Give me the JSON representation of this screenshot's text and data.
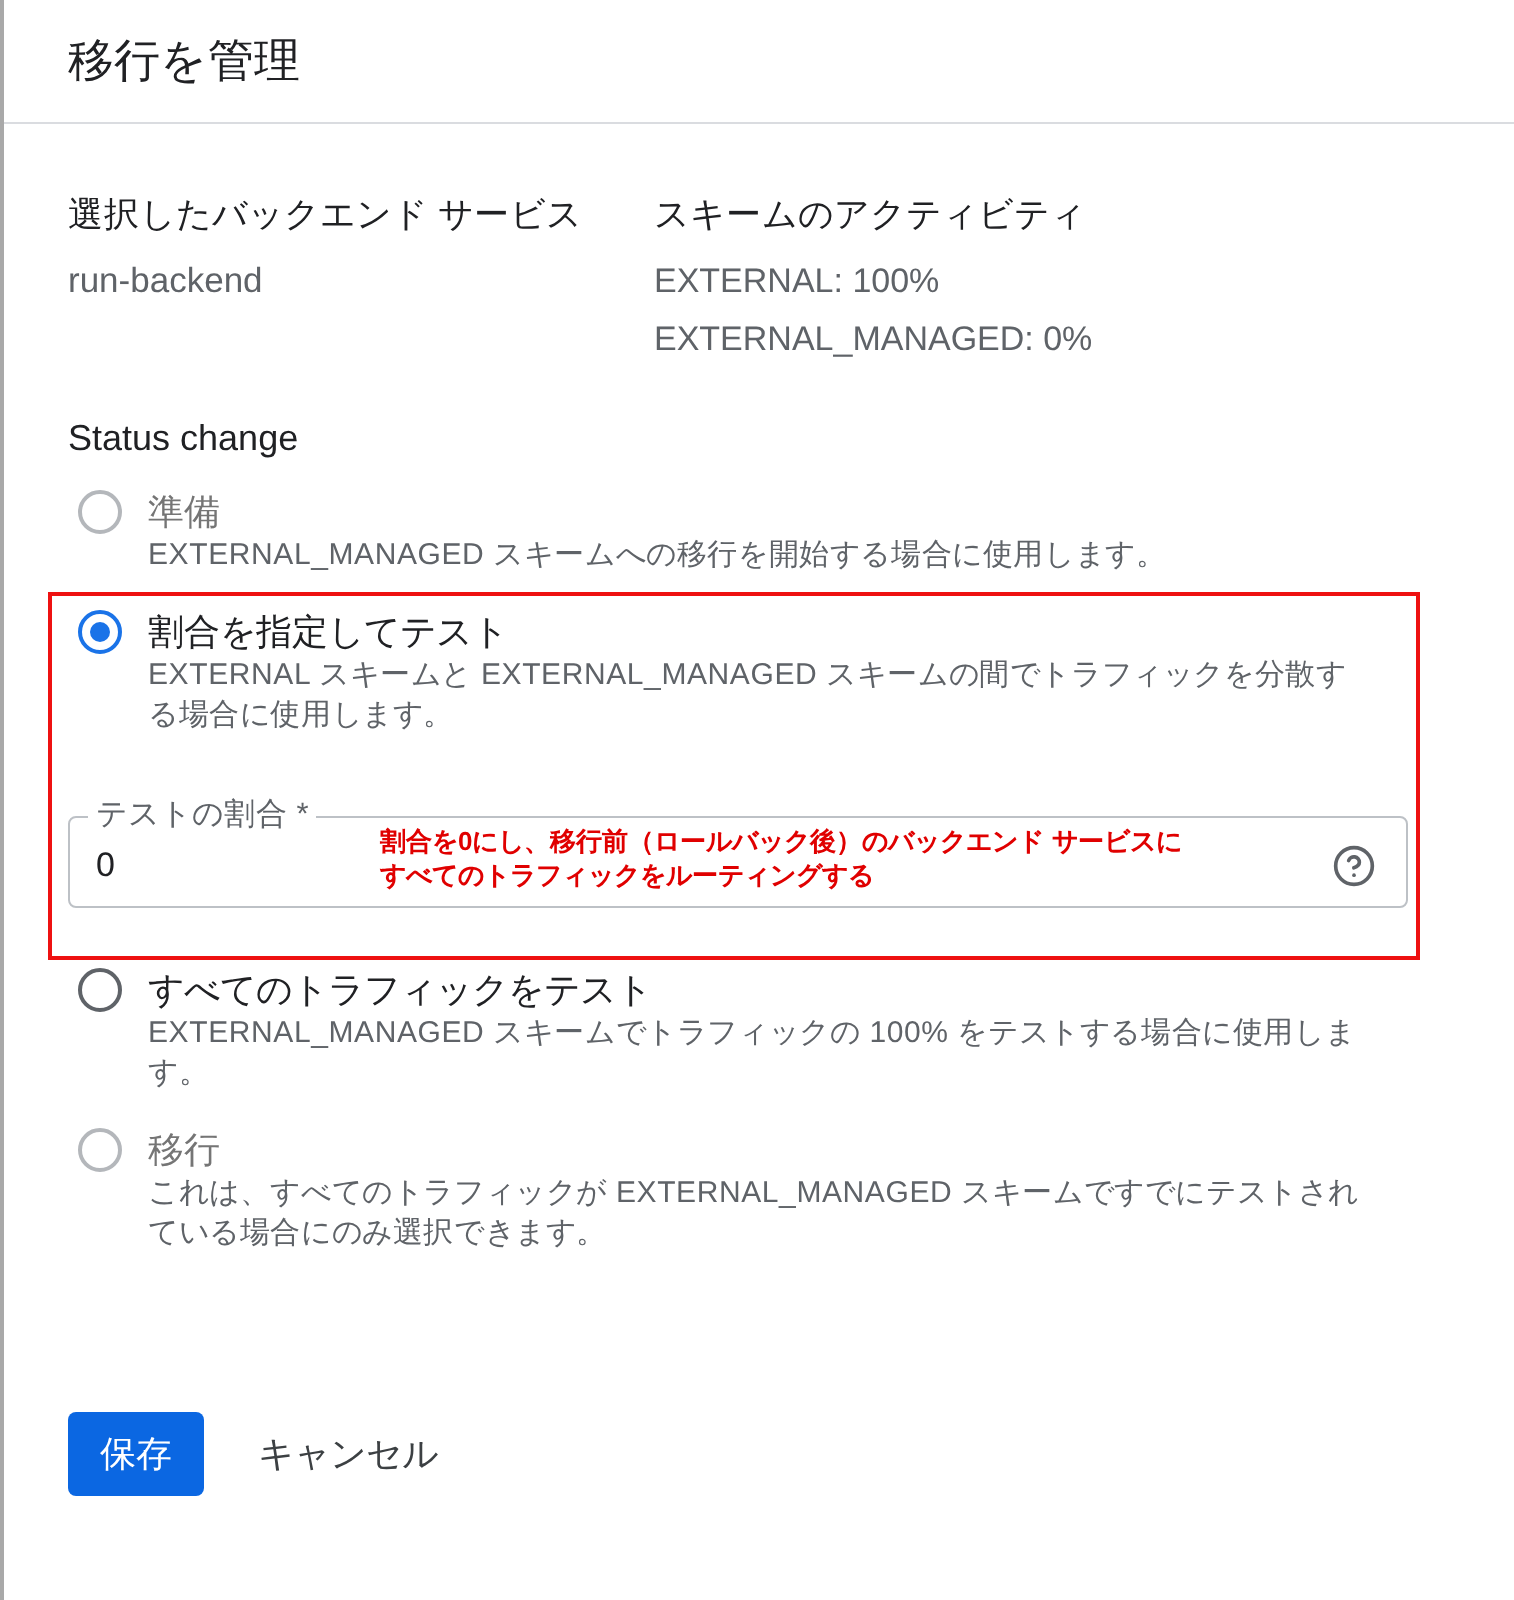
{
  "dialog": {
    "title": "移行を管理"
  },
  "summary": [
    {
      "heading": "選択したバックエンド サービス",
      "values": [
        "run-backend"
      ]
    },
    {
      "heading": "スキームのアクティビティ",
      "values": [
        "EXTERNAL: 100%",
        "EXTERNAL_MANAGED: 0%"
      ]
    }
  ],
  "status_change": {
    "heading": "Status change",
    "options": [
      {
        "label": "準備",
        "description": "EXTERNAL_MANAGED スキームへの移行を開始する場合に使用します。",
        "selected": false,
        "disabled": true,
        "highlighted": false
      },
      {
        "label": "割合を指定してテスト",
        "description": "EXTERNAL スキームと EXTERNAL_MANAGED スキームの間でトラフィックを分散する場合に使用します。",
        "selected": true,
        "disabled": false,
        "highlighted": true,
        "field": {
          "label": "テストの割合 *",
          "value": "0"
        },
        "annotation": "割合を0にし、移行前（ロールバック後）のバックエンド サービスにすべてのトラフィックをルーティングする"
      },
      {
        "label": "すべてのトラフィックをテスト",
        "description": "EXTERNAL_MANAGED スキームでトラフィックの 100% をテストする場合に使用します。",
        "selected": false,
        "disabled": false,
        "highlighted": false
      },
      {
        "label": "移行",
        "description": "これは、すべてのトラフィックが EXTERNAL_MANAGED スキームですでにテストされている場合にのみ選択できます。",
        "selected": false,
        "disabled": true,
        "highlighted": false
      }
    ]
  },
  "buttons": [
    {
      "label": "保存",
      "kind": "primary"
    },
    {
      "label": "キャンセル",
      "kind": "text"
    }
  ]
}
